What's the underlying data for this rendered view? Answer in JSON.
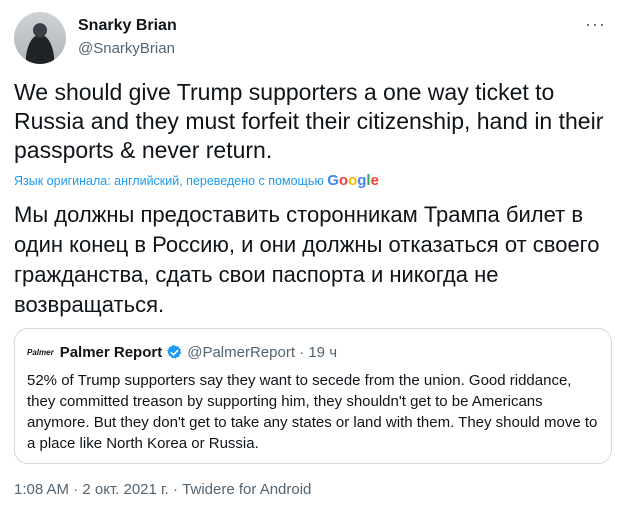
{
  "author": {
    "name": "Snarky Brian",
    "handle": "@SnarkyBrian",
    "more_label": "···"
  },
  "tweet": {
    "text": "We should give Trump supporters a one way ticket to Russia and they must forfeit their citizenship, hand in their passports & never return.",
    "translation_note": "Язык оригинала: английский, переведено с помощью",
    "translation_provider": "Google",
    "translated_text": "Мы должны предоставить сторонникам Трампа билет в один конец в Россию, и они должны отказаться от своего гражданства, сдать свои паспорта и никогда не возвращаться."
  },
  "quote": {
    "logo_text": "Palmer",
    "name": "Palmer Report",
    "handle": "@PalmerReport",
    "separator": "·",
    "time": "19 ч",
    "text": "52% of Trump supporters say they want to secede from the union. Good riddance, they committed treason by supporting him, they shouldn't get to be Americans anymore. But they don't get to take any states or land with them. They should move to a place like North Korea or Russia."
  },
  "footer": {
    "timestamp": "1:08 AM · 2 окт. 2021 г. · Twidere for Android"
  },
  "colors": {
    "link": "#1d9bf0",
    "verified": "#1d9bf0",
    "secondary_text": "#536471",
    "border": "#cfd9de"
  },
  "icons": {
    "verified": "verified-badge-icon",
    "more": "more-dots-icon"
  }
}
